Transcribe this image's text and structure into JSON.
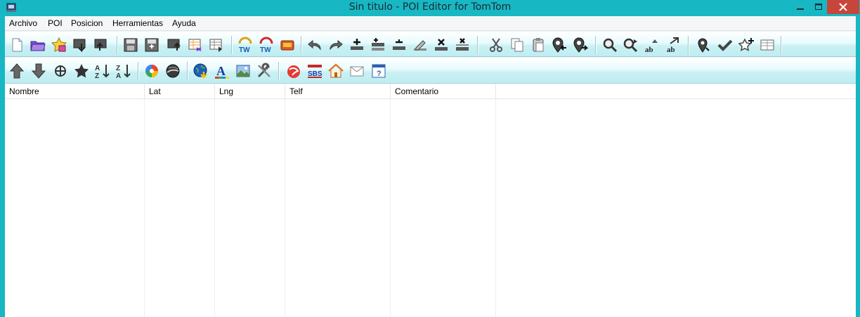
{
  "window": {
    "title": "Sin titulo - POI Editor for TomTom",
    "accent_color": "#18b7c4",
    "close_color": "#c7463b"
  },
  "menu": {
    "items": [
      "Archivo",
      "POI",
      "Posicion",
      "Herramientas",
      "Ayuda"
    ]
  },
  "toolbar1": {
    "icons": [
      "new-file-icon",
      "open-folder-icon",
      "favorite-star-icon",
      "import-icon",
      "export-icon",
      "save-icon",
      "save-as-icon",
      "upload-icon",
      "table-export-icon",
      "table-import-icon",
      "tomtom-read-icon",
      "tomtom-write-icon",
      "device-icon",
      "undo-icon",
      "redo-icon",
      "add-row-icon",
      "insert-row-icon",
      "remove-row-icon",
      "edit-row-icon",
      "delete-row-icon",
      "delete-all-icon",
      "cut-icon",
      "copy-icon",
      "paste-icon",
      "poi-prev-icon",
      "poi-next-icon",
      "search-icon",
      "search-next-icon",
      "replace-icon",
      "replace-all-icon",
      "locate-icon",
      "check-icon",
      "star-add-icon",
      "columns-icon"
    ]
  },
  "toolbar2": {
    "icons": [
      "move-up-icon",
      "move-down-icon",
      "crosshair-icon",
      "star-icon",
      "sort-az-icon",
      "sort-za-icon",
      "google-maps-icon",
      "google-earth-icon",
      "globe-download-icon",
      "font-icon",
      "image-icon",
      "tools-icon",
      "brand-icon",
      "sbs-icon",
      "home-icon",
      "mail-icon",
      "help-icon"
    ]
  },
  "grid": {
    "columns": [
      "Nombre",
      "Lat",
      "Lng",
      "Telf",
      "Comentario"
    ],
    "rows": []
  }
}
